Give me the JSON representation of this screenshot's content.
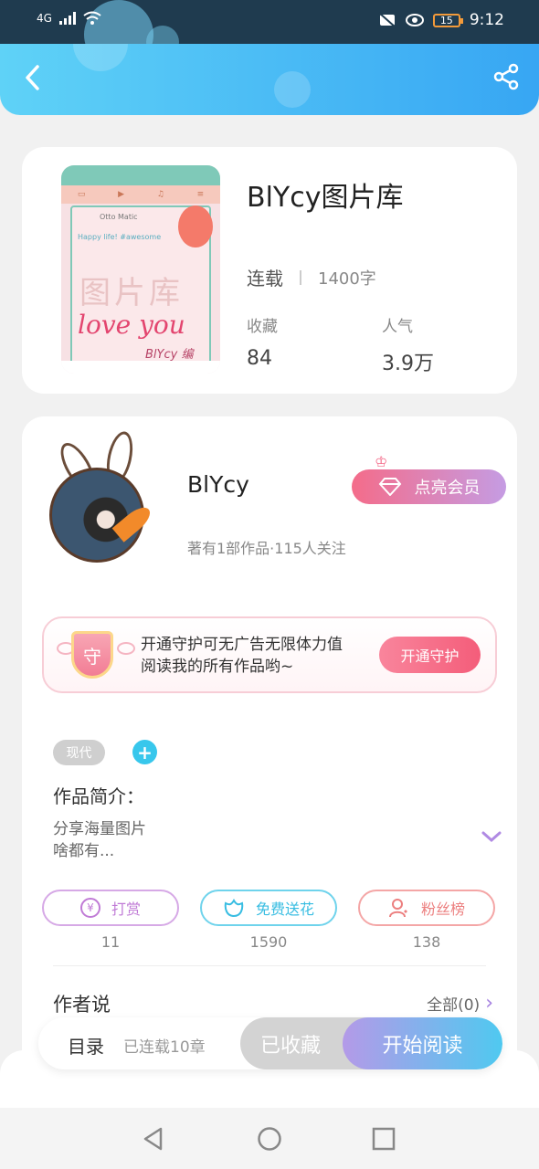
{
  "status": {
    "signal_label": "4G",
    "battery": "15",
    "time": "9:12"
  },
  "book": {
    "title": "BlYcy图片库",
    "status": "连载",
    "words": "1400字",
    "stats": [
      {
        "label": "收藏",
        "value": "84"
      },
      {
        "label": "人气",
        "value": "3.9万"
      }
    ],
    "cover": {
      "username": "Otto Matic",
      "caption": "Happy life! #awesome",
      "big_text": "图片库",
      "love_text": "love you",
      "signature": "BlYcy 编"
    }
  },
  "author": {
    "name": "BlYcy",
    "vip_label": "点亮会员",
    "subtitle": "著有1部作品·115人关注"
  },
  "guard": {
    "shield_char": "守",
    "line1": "开通守护可无广告无限体力值",
    "line2": "阅读我的所有作品哟~",
    "button": "开通守护"
  },
  "tags": {
    "items": [
      "现代"
    ],
    "add_label": "+"
  },
  "intro": {
    "label": "作品简介：",
    "line1": "分享海量图片",
    "line2": "啥都有..."
  },
  "actions": [
    {
      "label": "打赏",
      "count": "11",
      "icon": "yen-icon"
    },
    {
      "label": "免费送花",
      "count": "1590",
      "icon": "flower-icon"
    },
    {
      "label": "粉丝榜",
      "count": "138",
      "icon": "fan-rank-icon"
    }
  ],
  "author_says": {
    "label": "作者说",
    "all": "全部(0)"
  },
  "bottom": {
    "toc": "目录",
    "toc_sub": "已连载10章",
    "favorited": "已收藏",
    "start_reading": "开始阅读"
  },
  "colors": {
    "header_start": "#5fd2f7",
    "header_end": "#37a6f3",
    "vip": "#f46c8a",
    "accent_blue": "#38c7ec"
  }
}
